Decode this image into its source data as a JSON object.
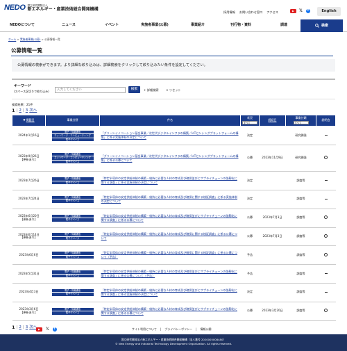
{
  "header": {
    "logo_mark": "NEDO",
    "logo_sub": "国立研究開発法人",
    "logo_main": "新エネルギー・産業技術総合開発機構",
    "top_links": [
      "採用情報",
      "お問い合わせ窓口",
      "アクセス"
    ],
    "lang_button": "English"
  },
  "gnav": {
    "items": [
      "NEDOについて",
      "ニュース",
      "イベント",
      "実施者事業(公募)",
      "事業紹介",
      "刊行物・資料",
      "調達"
    ],
    "search_label": "検索"
  },
  "breadcrumb": [
    "ホーム",
    "実施者事業(公募)",
    "公募情報一覧"
  ],
  "page_title": "公募情報一覧",
  "notice": "公募情報の検索ができます。より詳細な絞り込みは、詳細検索をクリックして絞り込みたい条件を設定してください。",
  "search": {
    "label": "キーワード",
    "sublabel": "(スペース区切りで絞り込み)",
    "placeholder": "入力してください",
    "button": "検索",
    "detail": "詳細検索",
    "reset": "リセット"
  },
  "results_count": "検索結果：21件",
  "pager": {
    "current": "1",
    "pages": [
      "2",
      "3"
    ],
    "next": "次へ"
  },
  "table": {
    "headers": {
      "date": "掲載日",
      "category": "事業分野",
      "title": "件名",
      "status": "状況",
      "status_select": "すべて",
      "deadline": "締切日",
      "type": "事業分類",
      "type_select": "すべて",
      "session": "説明会"
    },
    "rows": [
      {
        "date": "2024年1月16日",
        "updated": "",
        "categories": [
          "電子・情報通信",
          "ネットワーク・コンピューティング",
          "電子デバイス"
        ],
        "title": "「グリーンイノベーション基金事業／次世代デジタルインフラの構築／IoTセンシングプラットフォームの構築」に係る実施体制の決定について",
        "status": "決定",
        "deadline": "",
        "type": "研究開発",
        "session": "none"
      },
      {
        "date": "2023年9月26日",
        "updated": "【更新あり】",
        "categories": [
          "電子・情報通信",
          "ネットワーク・コンピューティング",
          "電子デバイス"
        ],
        "title": "「グリーンイノベーション基金事業／次世代デジタルインフラの構築／IoTセンシングプラットフォームの構築」に係る公募について",
        "status": "公募",
        "deadline": "2023年11月9日",
        "type": "研究開発",
        "session": "yes"
      },
      {
        "date": "2023年7月26日",
        "updated": "",
        "categories": [
          "電子・情報通信",
          "電子デバイス"
        ],
        "title": "「特定半導体の安定供給体制の構築・維持に必要な人材の育成及び確保並びにサプライチェーンの強靱化に関する調査」に係る実施体制の決定について",
        "status": "決定",
        "deadline": "",
        "type": "調査等",
        "session": "none"
      },
      {
        "date": "2023年7月24日",
        "updated": "",
        "categories": [
          "電子・情報通信",
          "電子デバイス"
        ],
        "title": "「特定半導体の安定供給体制の構築・維持に必要な人材の育成及び確保に関する検証調査」に係る実施体制の決定について",
        "status": "決定",
        "deadline": "",
        "type": "調査等",
        "session": "none"
      },
      {
        "date": "2023年6月20日",
        "updated": "【更新あり】",
        "categories": [
          "電子・情報通信",
          "電子デバイス"
        ],
        "title": "「特定半導体の安定供給体制の構築・維持に必要な人材の育成及び確保並びにサプライチェーンの強靱化に関する調査」に係る公募について",
        "status": "公募",
        "deadline": "2023年7月3日",
        "type": "調査等",
        "session": "yes"
      },
      {
        "date": "2023年6月14日",
        "updated": "【更新あり】",
        "categories": [
          "電子・情報通信",
          "電子デバイス"
        ],
        "title": "「特定半導体の安定供給体制の構築・維持に必要な人材の育成及び確保に関する検証調査」に係る公募について",
        "status": "公募",
        "deadline": "2023年7月3日",
        "type": "調査等",
        "session": "yes"
      },
      {
        "date": "2023年6月6日",
        "updated": "",
        "categories": [
          "電子・情報通信",
          "電子デバイス"
        ],
        "title": "「特定半導体の安定供給体制の構築・維持に必要な人材の育成及び確保に関する検証調査」に係る公募について（予告）",
        "status": "予告",
        "deadline": "",
        "type": "調査等",
        "session": "yes"
      },
      {
        "date": "2023年5月31日",
        "updated": "",
        "categories": [
          "電子・情報通信",
          "電子デバイス"
        ],
        "title": "「特定半導体の安定供給体制の構築・維持に必要な人材の育成及び確保並びにサプライチェーンの強靱化に関する調査」に係る公募について（予告）",
        "status": "予告",
        "deadline": "",
        "type": "調査等",
        "session": "none"
      },
      {
        "date": "2023年4月3日",
        "updated": "",
        "categories": [
          "電子・情報通信",
          "電子デバイス"
        ],
        "title": "「特定半導体の安定供給体制の構築・維持に必要な人材の育成及び確保並びにサプライチェーンの強靱化に関する調査」に係る実施体制の決定について",
        "status": "決定",
        "deadline": "",
        "type": "調査等",
        "session": "none"
      },
      {
        "date": "2023年3月6日",
        "updated": "【更新あり】",
        "categories": [
          "電子・情報通信",
          "電子デバイス"
        ],
        "title": "「特定半導体の安定供給体制の構築・維持に必要な人材の育成及び確保並びにサプライチェーンの強靱化に関する調査」に係る公募について",
        "status": "公募",
        "deadline": "2023年3月20日",
        "type": "調査等",
        "session": "yes"
      }
    ]
  },
  "footer": {
    "links": [
      "サイト利用について",
      "プライバシーポリシー",
      "情報公開"
    ],
    "address": "国立研究開発法人新エネルギー・産業技術総合開発機構（法人番号 2020005008480）",
    "copyright": "© New Energy and Industrial Technology Development Organization. All rights reserved."
  }
}
